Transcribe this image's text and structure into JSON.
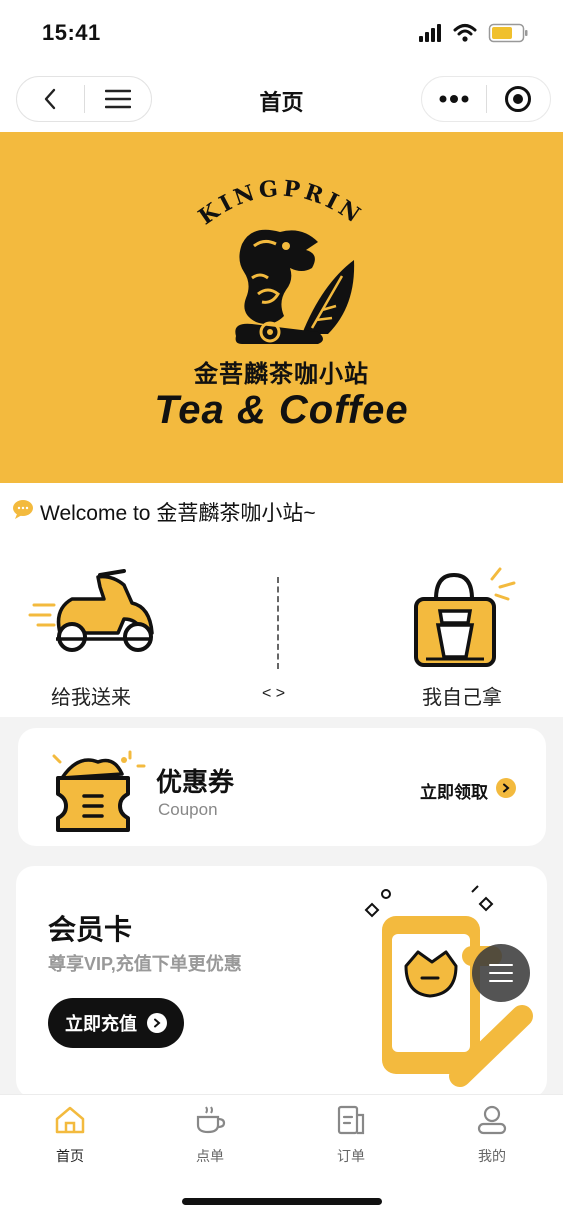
{
  "status": {
    "time": "15:41"
  },
  "nav": {
    "title": "首页"
  },
  "banner": {
    "brand_arc": "KINGPRIN",
    "name_cn": "金菩麟茶咖小站",
    "name_en": "Tea & Coffee",
    "bg_color": "#f3ba3e"
  },
  "welcome": {
    "text": "Welcome to 金菩麟茶咖小站~"
  },
  "modes": {
    "delivery": "给我送来",
    "pickup": "我自己拿",
    "arrows": "< >"
  },
  "coupon": {
    "title": "优惠券",
    "subtitle": "Coupon",
    "action": "立即领取"
  },
  "vip": {
    "title": "会员卡",
    "subtitle": "尊享VIP,充值下单更优惠",
    "button": "立即充值"
  },
  "tabs": [
    {
      "label": "首页",
      "icon": "home-icon",
      "active": true
    },
    {
      "label": "点单",
      "icon": "cup-icon",
      "active": false
    },
    {
      "label": "订单",
      "icon": "order-icon",
      "active": false
    },
    {
      "label": "我的",
      "icon": "profile-icon",
      "active": false
    }
  ],
  "colors": {
    "accent": "#f3ba3e",
    "dark": "#111111"
  }
}
